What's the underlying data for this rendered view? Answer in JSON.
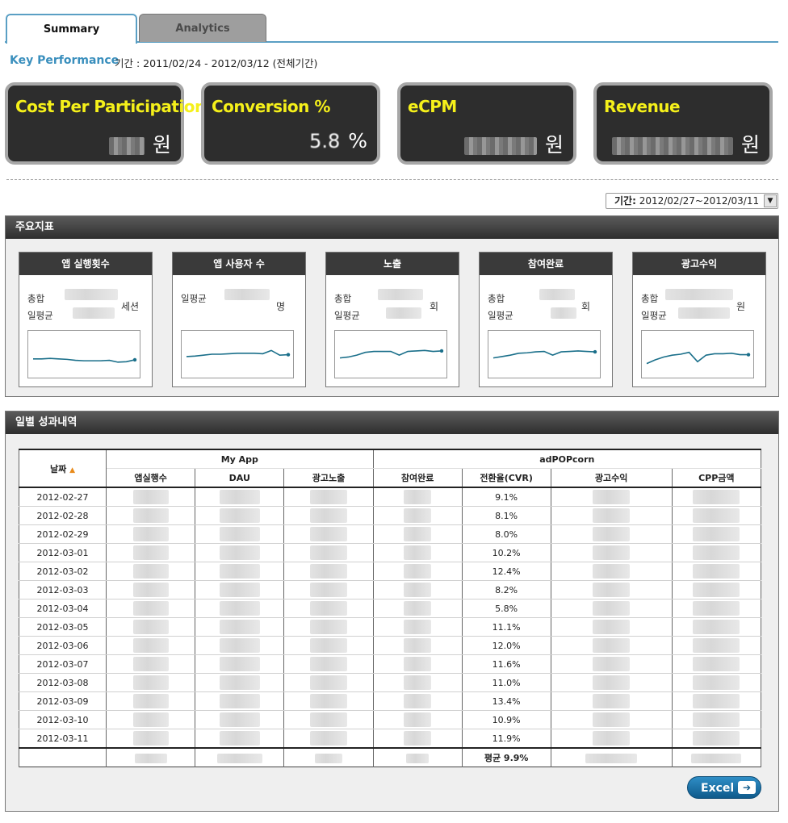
{
  "tabs": [
    {
      "label": "Summary",
      "active": true
    },
    {
      "label": "Analytics",
      "active": false
    }
  ],
  "key_performance": {
    "title": "Key Performance",
    "period": "기간 : 2011/02/24 - 2012/03/12 (전체기간)"
  },
  "kpis": [
    {
      "label": "Cost Per Participation",
      "value": "",
      "unit": "원"
    },
    {
      "label": "Conversion %",
      "value": "5.8",
      "unit": "%"
    },
    {
      "label": "eCPM",
      "value": "",
      "unit": "원"
    },
    {
      "label": "Revenue",
      "value": "",
      "unit": "원"
    }
  ],
  "period_select": {
    "label": "기간:",
    "value": "2012/02/27~2012/03/11"
  },
  "main_indicators": {
    "title": "주요지표",
    "cards": [
      {
        "title": "앱 실행횟수",
        "row1_label": "총합",
        "row2_label": "일평균",
        "unit": "세션",
        "spark": [
          60,
          60,
          59,
          60,
          61,
          63,
          64,
          64,
          64,
          63,
          67,
          66,
          62
        ]
      },
      {
        "title": "앱 사용자 수",
        "row1_label": "일평균",
        "row2_label": "",
        "unit": "명",
        "spark": [
          55,
          54,
          52,
          50,
          50,
          49,
          48,
          48,
          48,
          49,
          42,
          52,
          51
        ]
      },
      {
        "title": "노출",
        "row1_label": "총합",
        "row2_label": "일평균",
        "unit": "회",
        "spark": [
          58,
          56,
          52,
          46,
          44,
          44,
          44,
          52,
          44,
          43,
          42,
          44,
          43
        ]
      },
      {
        "title": "참여완료",
        "row1_label": "총합",
        "row2_label": "일평균",
        "unit": "회",
        "spark": [
          58,
          55,
          52,
          48,
          47,
          45,
          44,
          52,
          45,
          44,
          43,
          44,
          45
        ]
      },
      {
        "title": "광고수익",
        "row1_label": "총합",
        "row2_label": "일평균",
        "unit": "원",
        "spark": [
          70,
          62,
          56,
          52,
          50,
          46,
          66,
          52,
          49,
          49,
          48,
          51,
          51
        ]
      }
    ]
  },
  "daily": {
    "title": "일별 성과내역",
    "group_myapp": "My App",
    "group_adpop": "adPOPcorn",
    "date_header": "날짜",
    "columns": [
      "앱실행수",
      "DAU",
      "광고노출",
      "참여완료",
      "전환율(CVR)",
      "광고수익",
      "CPP금액"
    ],
    "rows": [
      {
        "date": "2012-02-27",
        "cvr": "9.1%"
      },
      {
        "date": "2012-02-28",
        "cvr": "8.1%"
      },
      {
        "date": "2012-02-29",
        "cvr": "8.0%"
      },
      {
        "date": "2012-03-01",
        "cvr": "10.2%"
      },
      {
        "date": "2012-03-02",
        "cvr": "12.4%"
      },
      {
        "date": "2012-03-03",
        "cvr": "8.2%"
      },
      {
        "date": "2012-03-04",
        "cvr": "5.8%"
      },
      {
        "date": "2012-03-05",
        "cvr": "11.1%"
      },
      {
        "date": "2012-03-06",
        "cvr": "12.0%"
      },
      {
        "date": "2012-03-07",
        "cvr": "11.6%"
      },
      {
        "date": "2012-03-08",
        "cvr": "11.0%"
      },
      {
        "date": "2012-03-09",
        "cvr": "13.4%"
      },
      {
        "date": "2012-03-10",
        "cvr": "10.9%"
      },
      {
        "date": "2012-03-11",
        "cvr": "11.9%"
      }
    ],
    "total_cvr": "평균 9.9%"
  },
  "excel_button": {
    "label": "Excel",
    "icon": "export-arrow-icon"
  },
  "colors": {
    "accent": "#3a8fbd",
    "kpi_label": "#f5f01a",
    "spark": "#1a6f8a"
  }
}
